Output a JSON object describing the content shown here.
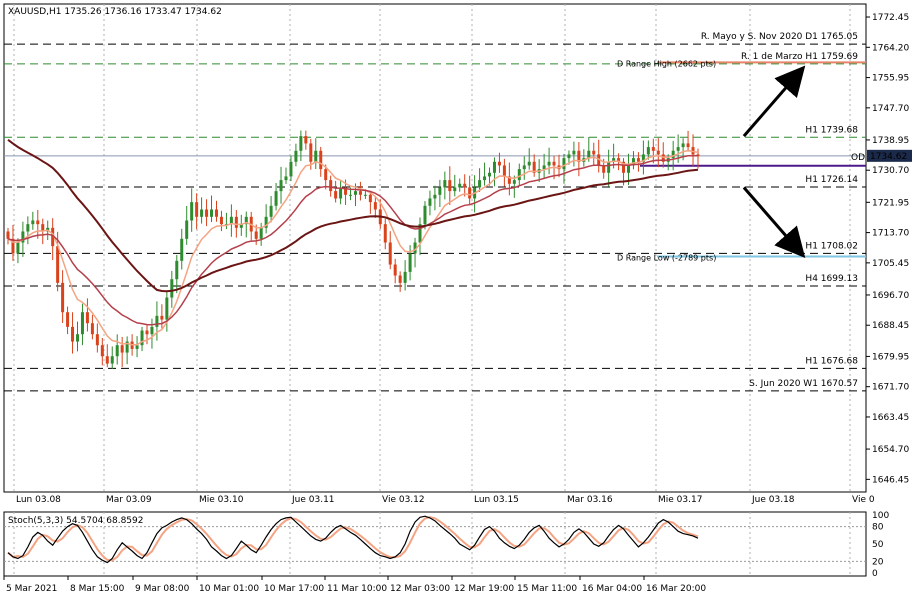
{
  "header": {
    "symbol_info": "XAUUSD,H1  1735.26 1736.16 1733.47 1734.62",
    "stoch_info": "Stoch(5,3,3) 54.5704 68.8592"
  },
  "chart_data": {
    "type": "candlestick",
    "symbol": "XAUUSD",
    "timeframe": "H1",
    "ohlc_last": {
      "open": 1735.26,
      "high": 1736.16,
      "low": 1733.47,
      "close": 1734.62
    },
    "ylim": [
      1643.0,
      1776.0
    ],
    "y_ticks": [
      "1772.45",
      "1764.20",
      "1755.95",
      "1747.70",
      "1738.95",
      "1730.70",
      "1721.95",
      "1713.70",
      "1705.45",
      "1696.70",
      "1688.45",
      "1679.95",
      "1671.70",
      "1663.45",
      "1654.70",
      "1646.45"
    ],
    "x_tick_labels": [
      "Lun 03.08",
      "Mar 03.09",
      "Mie 03.10",
      "Jue 03.11",
      "Vie 03.12",
      "Lun 03.15",
      "Mar 03.16",
      "Mie 03.17",
      "Jue 03.18",
      "Vie 0"
    ],
    "bottom_axis_labels": [
      "5 Mar 2021",
      "8 Mar 15:00",
      "9 Mar 08:00",
      "10 Mar 01:00",
      "10 Mar 17:00",
      "11 Mar 10:00",
      "12 Mar 03:00",
      "12 Mar 19:00",
      "15 Mar 11:00",
      "16 Mar 04:00",
      "16 Mar 20:00"
    ],
    "current_price": {
      "label": "1734.62",
      "value": 1734.62
    },
    "od_line": {
      "label": "OD",
      "value": 1734.0
    },
    "levels": [
      {
        "label": "R. Mayo y S. Nov 2020 D1 1765.05",
        "value": 1765.05,
        "color": "#000000",
        "style": "dashed"
      },
      {
        "label": "R. 1 de Marzo H1 1759.69",
        "value": 1759.69,
        "color": "#2e8b2e",
        "style": "dashed"
      },
      {
        "label": "D Range High (2662 pts)",
        "value": 1760.1,
        "color": "#e8836a",
        "style": "solid"
      },
      {
        "label": "H1 1739.68",
        "value": 1739.68,
        "color": "#2e8b2e",
        "style": "dashed"
      },
      {
        "label": "",
        "value": 1731.9,
        "color": "#4b1a8a",
        "style": "solid"
      },
      {
        "label": "H1 1726.14",
        "value": 1726.14,
        "color": "#000000",
        "style": "dashed"
      },
      {
        "label": "H1 1708.02",
        "value": 1708.02,
        "color": "#000000",
        "style": "dashed"
      },
      {
        "label": "D Range Low (-2789 pts)",
        "value": 1707.2,
        "color": "#7fc4e0",
        "style": "solid"
      },
      {
        "label": "H4 1699.13",
        "value": 1699.13,
        "color": "#000000",
        "style": "dashed"
      },
      {
        "label": "H1 1676.68",
        "value": 1676.68,
        "color": "#000000",
        "style": "dashed"
      },
      {
        "label": "S. Jun 2020 W1 1670.57",
        "value": 1670.57,
        "color": "#000000",
        "style": "dashed"
      }
    ],
    "candles": {
      "count": 140,
      "closes": [
        1712,
        1708,
        1711,
        1714,
        1716,
        1717,
        1716,
        1714,
        1715,
        1710,
        1700,
        1692,
        1688,
        1684,
        1686,
        1692,
        1689,
        1686,
        1683,
        1680,
        1678,
        1680,
        1683,
        1681,
        1684,
        1682,
        1683,
        1687,
        1686,
        1688,
        1691,
        1690,
        1696,
        1701,
        1706,
        1712,
        1717,
        1722,
        1718,
        1720,
        1718,
        1720,
        1718,
        1716,
        1716,
        1718,
        1715,
        1716,
        1718,
        1714,
        1712,
        1715,
        1718,
        1721,
        1725,
        1728,
        1729,
        1733,
        1736,
        1740,
        1738,
        1733,
        1736,
        1731,
        1728,
        1725,
        1723,
        1726,
        1724,
        1724,
        1725,
        1724,
        1724,
        1722,
        1720,
        1716,
        1711,
        1705,
        1702,
        1700,
        1703,
        1708,
        1711,
        1716,
        1721,
        1723,
        1724,
        1726,
        1728,
        1725,
        1726,
        1727,
        1726,
        1723,
        1726,
        1728,
        1729,
        1730,
        1733,
        1732,
        1729,
        1727,
        1728,
        1731,
        1732,
        1733,
        1730,
        1731,
        1732,
        1733,
        1732,
        1731,
        1734,
        1735,
        1736,
        1733,
        1734,
        1736,
        1735,
        1732,
        1730,
        1733,
        1734,
        1733,
        1730,
        1732,
        1734,
        1733,
        1735,
        1737,
        1736,
        1735,
        1733,
        1734,
        1736,
        1737,
        1738,
        1737,
        1735,
        1734.62
      ],
      "up_color": "#2e8b2e",
      "down_color": "#d9421b"
    },
    "series": [
      {
        "values_from": "ema_fast",
        "color": "#f4a483",
        "width": 1.5
      },
      {
        "values_from": "ema_mid",
        "color": "#b5404b",
        "width": 1.5
      },
      {
        "values_from": "ma_slow",
        "color": "#6b1515",
        "width": 2
      }
    ],
    "arrows": [
      {
        "from": [
          103,
          1740
        ],
        "to": [
          111,
          1758
        ]
      },
      {
        "from": [
          103,
          1726
        ],
        "to": [
          111,
          1708
        ]
      }
    ],
    "stochastic": {
      "params": "5,3,3",
      "main": 54.5704,
      "signal": 68.8592,
      "levels": [
        20,
        80
      ],
      "y_ticks": [
        "100",
        "80",
        "50",
        "20",
        "0"
      ],
      "main_color": "#000000",
      "signal_color": "#f4a483",
      "values": [
        35,
        28,
        25,
        30,
        45,
        62,
        70,
        65,
        55,
        48,
        60,
        72,
        80,
        85,
        82,
        70,
        55,
        40,
        28,
        22,
        18,
        25,
        40,
        52,
        45,
        38,
        30,
        25,
        35,
        52,
        68,
        78,
        82,
        88,
        92,
        95,
        92,
        85,
        76,
        68,
        58,
        45,
        38,
        30,
        25,
        30,
        42,
        55,
        48,
        40,
        35,
        48,
        62,
        75,
        85,
        92,
        95,
        96,
        88,
        80,
        72,
        64,
        58,
        55,
        60,
        70,
        78,
        82,
        76,
        70,
        65,
        58,
        50,
        42,
        35,
        30,
        28,
        25,
        28,
        35,
        50,
        72,
        88,
        96,
        98,
        95,
        90,
        82,
        75,
        68,
        60,
        50,
        45,
        40,
        48,
        62,
        75,
        80,
        72,
        60,
        52,
        46,
        42,
        48,
        58,
        70,
        78,
        82,
        72,
        60,
        52,
        45,
        50,
        58,
        70,
        76,
        70,
        60,
        50,
        46,
        52,
        64,
        75,
        82,
        76,
        65,
        55,
        45,
        52,
        62,
        74,
        86,
        92,
        88,
        80,
        72,
        68,
        66,
        64,
        60
      ]
    }
  }
}
